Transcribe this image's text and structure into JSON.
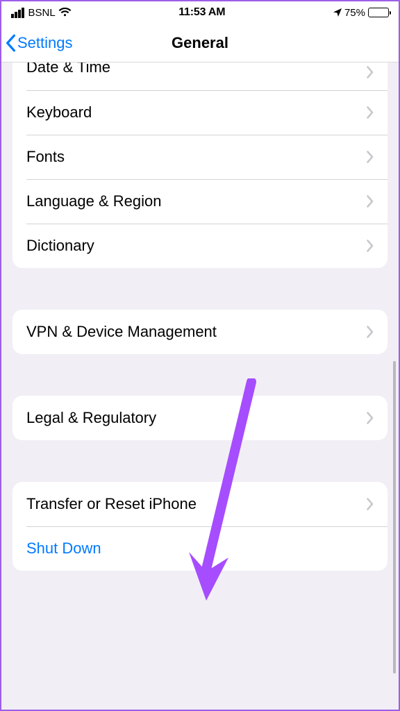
{
  "status": {
    "carrier": "BSNL",
    "time": "11:53 AM",
    "battery": "75%"
  },
  "nav": {
    "back": "Settings",
    "title": "General"
  },
  "sections": {
    "s0": {
      "date_time": "Date & Time",
      "keyboard": "Keyboard",
      "fonts": "Fonts",
      "language_region": "Language & Region",
      "dictionary": "Dictionary"
    },
    "s1": {
      "vpn": "VPN & Device Management"
    },
    "s2": {
      "legal": "Legal & Regulatory"
    },
    "s3": {
      "transfer_reset": "Transfer or Reset iPhone",
      "shut_down": "Shut Down"
    }
  },
  "annotation": {
    "arrow_color": "#a64dff"
  }
}
